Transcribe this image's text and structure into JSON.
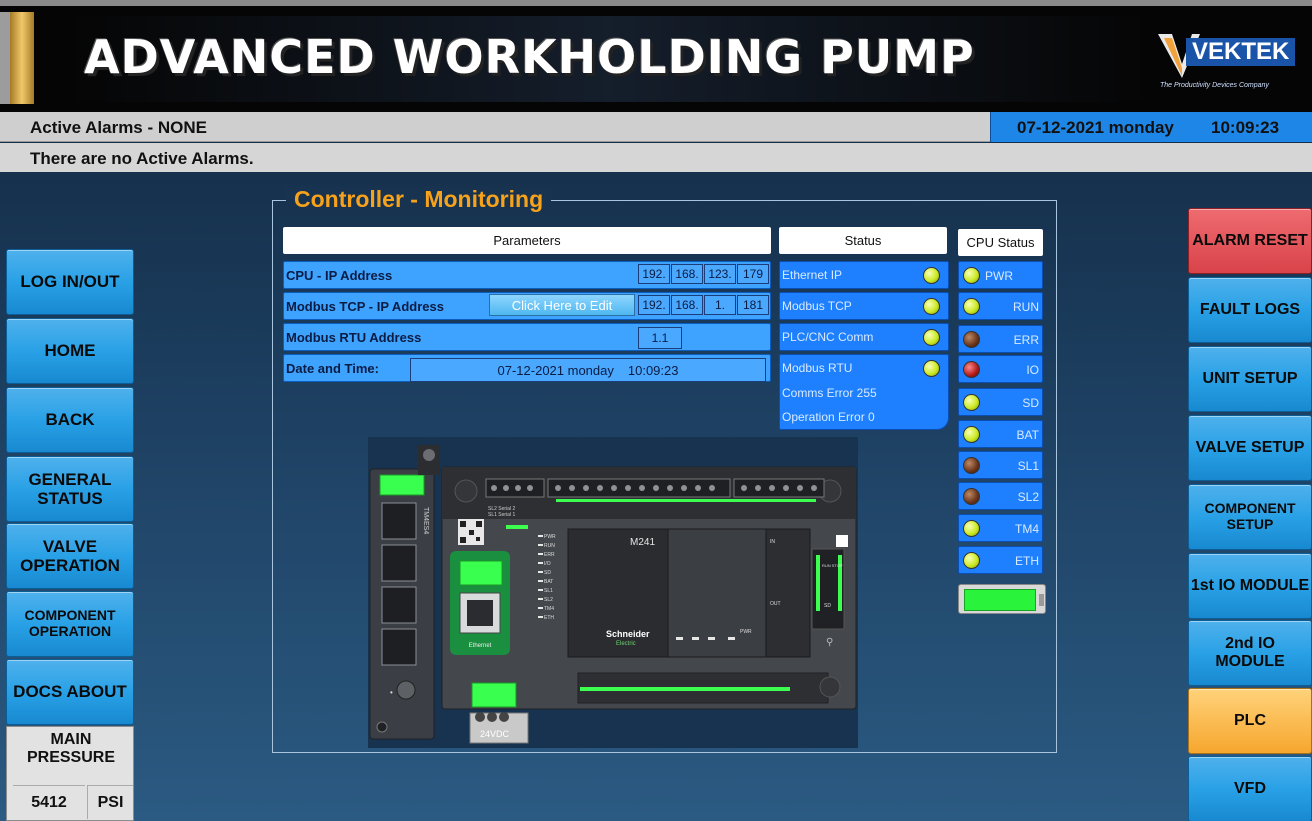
{
  "banner": {
    "title": "ADVANCED WORKHOLDING PUMP",
    "logo_name": "VEKTEK",
    "logo_tagline": "The Productivity Devices Company"
  },
  "alarms": {
    "header": "Active Alarms - NONE",
    "message": "There are no Active Alarms.",
    "date": "07-12-2021 monday",
    "time": "10:09:23"
  },
  "left_nav": {
    "login": "LOG IN/OUT",
    "home": "HOME",
    "back": "BACK",
    "general_status": "GENERAL STATUS",
    "valve_operation": "VALVE OPERATION",
    "component_operation": "COMPONENT OPERATION",
    "docs_about": "DOCS ABOUT"
  },
  "pressure": {
    "label": "MAIN PRESSURE",
    "value": "5412",
    "unit": "PSI"
  },
  "right_nav": {
    "alarm_reset": "ALARM RESET",
    "fault_logs": "FAULT LOGS",
    "unit_setup": "UNIT SETUP",
    "valve_setup": "VALVE SETUP",
    "component_setup": "COMPONENT SETUP",
    "io_module_1": "1st IO MODULE",
    "io_module_2": "2nd IO MODULE",
    "plc": "PLC",
    "vfd": "VFD"
  },
  "panel": {
    "title": "Controller - Monitoring",
    "parameters_header": "Parameters",
    "status_header": "Status",
    "cpu_status_header": "CPU Status",
    "cpu_ip_label": "CPU - IP Address",
    "cpu_ip": [
      "192.",
      "168.",
      "123.",
      "179"
    ],
    "modbus_tcp_label": "Modbus TCP - IP Address",
    "edit_button": "Click Here to Edit",
    "modbus_tcp_ip": [
      "192.",
      "168.",
      "1.",
      "181"
    ],
    "modbus_rtu_label": "Modbus RTU Address",
    "modbus_rtu_value": "1.1",
    "date_time_label": "Date and Time:",
    "date_value": "07-12-2021 monday",
    "time_value": "10:09:23"
  },
  "status": {
    "ethernet_ip": "Ethernet IP",
    "modbus_tcp": "Modbus TCP",
    "plc_cnc_comm": "PLC/CNC Comm",
    "modbus_rtu": "Modbus RTU",
    "comms_error": "Comms Error 255",
    "operation_error": "Operation Error 0"
  },
  "cpu_status": [
    "PWR",
    "RUN",
    "ERR",
    "IO",
    "SD",
    "BAT",
    "SL1",
    "SL2",
    "TM4",
    "ETH"
  ],
  "cpu_status_led": [
    "on",
    "on",
    "brown",
    "red",
    "on",
    "on",
    "brown",
    "brown",
    "on",
    "on"
  ],
  "plc_labels": {
    "model": "M241",
    "brand": "Schneider",
    "brand_sub": "Electric",
    "module": "TM4ES4",
    "ethernet": "Ethernet",
    "power": "24VDC",
    "run_stop": "RUN STOP",
    "pwr": "PWR",
    "in": "IN",
    "out": "OUT",
    "sd": "SD",
    "serial": "SL1 Serial 1",
    "serial2": "SL2 Serial 2",
    "led_labels": [
      "PWR",
      "RUN",
      "ERR",
      "I/O",
      "SD",
      "BAT",
      "SL1",
      "SL2",
      "TM4",
      "ETH"
    ]
  }
}
